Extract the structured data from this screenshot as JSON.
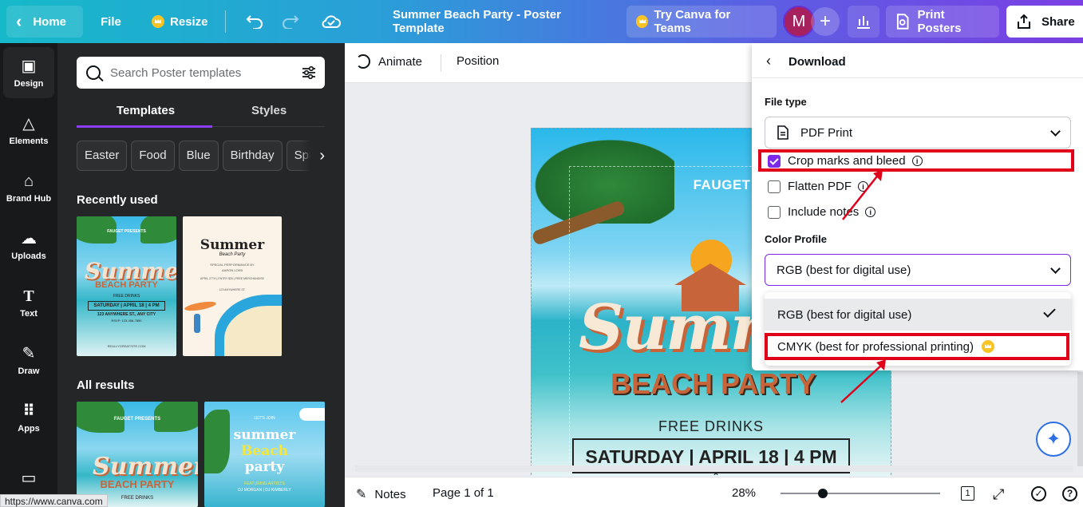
{
  "topbar": {
    "home": "Home",
    "file": "File",
    "resize": "Resize",
    "title": "Summer Beach Party - Poster Template",
    "teams": "Try Canva for Teams",
    "avatar": "M",
    "print": "Print Posters",
    "share": "Share"
  },
  "rail": {
    "design": "Design",
    "elements": "Elements",
    "brand_hub": "Brand Hub",
    "uploads": "Uploads",
    "text": "Text",
    "draw": "Draw",
    "apps": "Apps"
  },
  "panel": {
    "search_placeholder": "Search Poster templates",
    "tab_templates": "Templates",
    "tab_styles": "Styles",
    "chips": [
      "Easter",
      "Food",
      "Blue",
      "Birthday",
      "Sprin"
    ],
    "recently_used": "Recently used",
    "all_results": "All results"
  },
  "thumbs": {
    "t1_presents": "FAUGET PRESENTS",
    "t1_summer": "Summer",
    "t1_beach": "BEACH PARTY",
    "t1_drinks": "FREE DRINKS",
    "t1_date": "SATURDAY | APRIL 18 | 4 PM",
    "t1_addr": "123 ANYWHERE ST., ANY CITY",
    "t1_rsvp": "RSVP: 123-456-7890",
    "t1_site": "REALLYGREATSITE.COM",
    "t2_summer": "Summer",
    "t2_beach": "Beach Party",
    "t2_line1": "SPECIAL PERFORMANCE BY",
    "t2_line2": "AARON LOEB",
    "t2_line3": "APRIL 27TH | ENTRY $25 | FREE MERCHANDISE",
    "t2_line4": "123 ANYWHERE ST.",
    "t3_presents": "FAUGET PRESENTS",
    "t3_summer": "Summer",
    "t3_beach": "BEACH PARTY",
    "t3_drinks": "FREE DRINKS",
    "t4_top": "LET'S JOIN",
    "t4_summer": "summer",
    "t4_beach": "Beach",
    "t4_party": "party",
    "t4_bottom": "FEATURING ARTISTS",
    "t4_bottom2": "DJ MORGAN | DJ KIMBERLY"
  },
  "canvas_bar": {
    "animate": "Animate",
    "position": "Position"
  },
  "poster": {
    "presents": "FAUGET PRESENTS",
    "summer": "Summer",
    "beach": "BEACH PARTY",
    "drinks": "FREE DRINKS",
    "date": "SATURDAY | APRIL 18 | 4 PM"
  },
  "download": {
    "title": "Download",
    "file_type_label": "File type",
    "file_type_value": "PDF Print",
    "crop": "Crop marks and bleed",
    "flatten": "Flatten PDF",
    "notes": "Include notes",
    "color_profile_label": "Color Profile",
    "color_profile_value": "RGB (best for digital use)",
    "option_rgb": "RGB (best for digital use)",
    "option_cmyk": "CMYK (best for professional printing)"
  },
  "bottombar": {
    "notes": "Notes",
    "page": "Page 1 of 1",
    "zoom": "28%",
    "page_num": "1"
  },
  "status_url": "https://www.canva.com",
  "colors": {
    "accent": "#8b3dff",
    "highlight": "#e0001a"
  }
}
